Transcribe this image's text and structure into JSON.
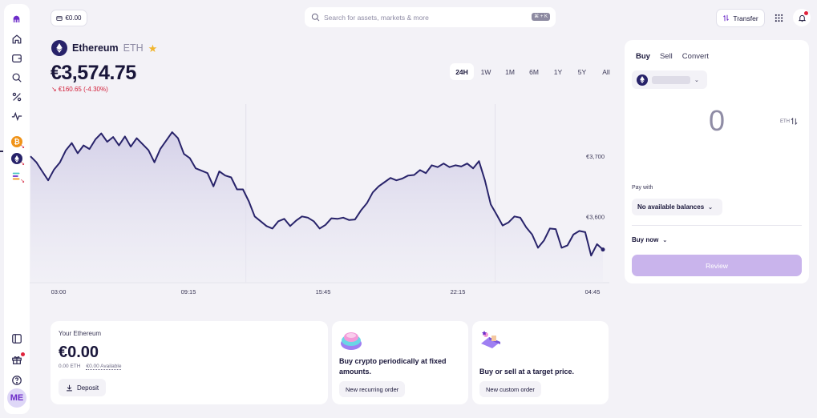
{
  "header": {
    "balance_pill": "€0.00",
    "search_placeholder": "Search for assets, markets & more",
    "search_shortcut": "⌘ + K",
    "transfer_label": "Transfer"
  },
  "sidebar": {
    "avatar_initials": "ME",
    "items": [
      {
        "icon": "kraken-logo-icon"
      },
      {
        "icon": "home-icon"
      },
      {
        "icon": "wallet-icon"
      },
      {
        "icon": "search-icon"
      },
      {
        "icon": "percent-icon"
      },
      {
        "icon": "activity-icon"
      },
      {
        "icon": "bitcoin-icon"
      },
      {
        "icon": "ethereum-icon"
      },
      {
        "icon": "watchlist-icon"
      },
      {
        "icon": "panel-icon"
      },
      {
        "icon": "gift-icon"
      },
      {
        "icon": "help-icon"
      }
    ]
  },
  "asset": {
    "name": "Ethereum",
    "ticker": "ETH",
    "price": "€3,574.75",
    "change": "↘ €160.65 (-4.30%)"
  },
  "ranges": [
    "24H",
    "1W",
    "1M",
    "6M",
    "1Y",
    "5Y",
    "All"
  ],
  "active_range": "24H",
  "chart_data": {
    "type": "area",
    "x_ticks": [
      "03:00",
      "09:15",
      "15:45",
      "22:15",
      "04:45"
    ],
    "y_ticks": [
      "€3,700",
      "€3,600"
    ],
    "ylim": [
      3490,
      3800
    ],
    "series": [
      {
        "values": [
          3700,
          3690,
          3675,
          3660,
          3678,
          3690,
          3710,
          3722,
          3705,
          3718,
          3712,
          3728,
          3738,
          3724,
          3732,
          3718,
          3733,
          3716,
          3730,
          3720,
          3710,
          3690,
          3712,
          3726,
          3740,
          3730,
          3704,
          3697,
          3680,
          3676,
          3672,
          3650,
          3675,
          3668,
          3665,
          3645,
          3645,
          3625,
          3600,
          3592,
          3584,
          3580,
          3592,
          3596,
          3584,
          3593,
          3600,
          3598,
          3592,
          3580,
          3586,
          3597,
          3596,
          3598,
          3594,
          3595,
          3610,
          3622,
          3640,
          3650,
          3657,
          3664,
          3660,
          3663,
          3668,
          3669,
          3677,
          3672,
          3685,
          3682,
          3688,
          3682,
          3685,
          3683,
          3688,
          3680,
          3692,
          3660,
          3620,
          3603,
          3585,
          3590,
          3600,
          3598,
          3582,
          3570,
          3548,
          3560,
          3580,
          3579,
          3548,
          3552,
          3570,
          3576,
          3574,
          3535,
          3554,
          3545
        ],
        "color": "#28236a"
      }
    ]
  },
  "your_holdings": {
    "title": "Your Ethereum",
    "amount": "€0.00",
    "eth_amount": "0.00 ETH",
    "available": "€0.00 Available",
    "deposit_label": "Deposit"
  },
  "promos": {
    "recurring_text": "Buy crypto periodically at fixed amounts.",
    "recurring_btn": "New recurring order",
    "target_text": "Buy or sell at a target price.",
    "target_btn": "New custom order"
  },
  "trade": {
    "tabs": [
      "Buy",
      "Sell",
      "Convert"
    ],
    "amount": "0",
    "unit": "ETH",
    "pay_with_label": "Pay with",
    "pay_with_value": "No available balances",
    "buy_mode": "Buy now",
    "review_label": "Review"
  },
  "colors": {
    "accent": "#6d2cc9",
    "line": "#28236a",
    "negative": "#d3203a",
    "review_disabled": "#c9b4ec",
    "star": "#f1b52d"
  }
}
